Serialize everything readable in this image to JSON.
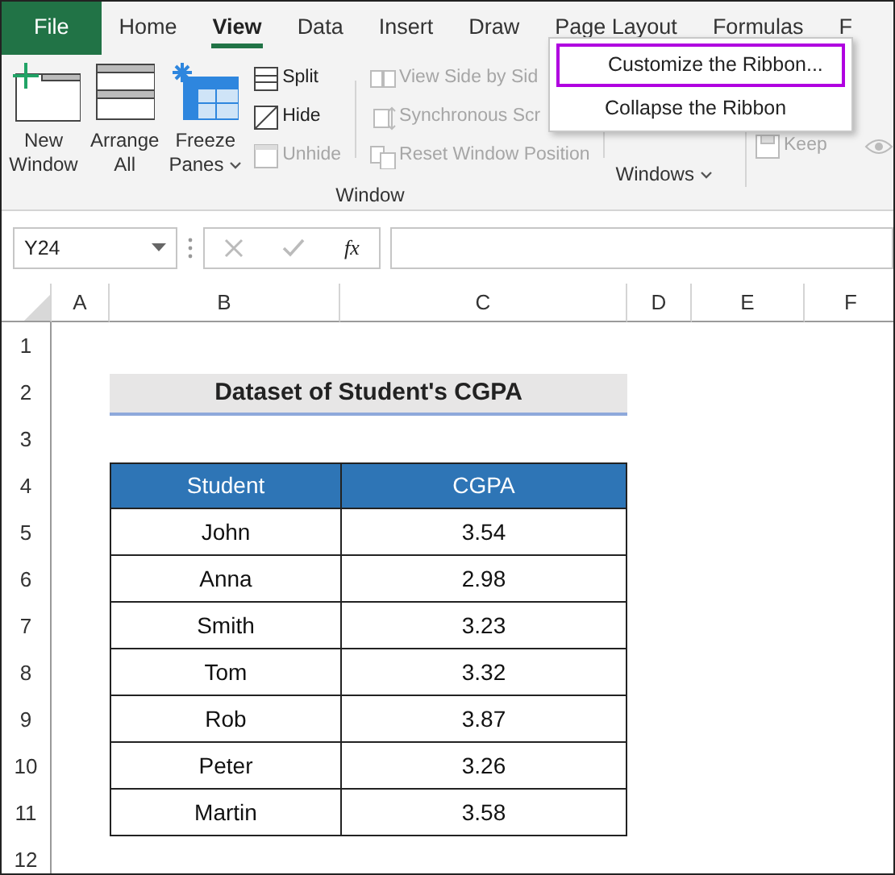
{
  "tabs": [
    {
      "label": "File",
      "kind": "file",
      "selected": false
    },
    {
      "label": "Home",
      "kind": "tab",
      "selected": false
    },
    {
      "label": "View",
      "kind": "tab",
      "selected": true
    },
    {
      "label": "Data",
      "kind": "tab",
      "selected": false
    },
    {
      "label": "Insert",
      "kind": "tab",
      "selected": false
    },
    {
      "label": "Draw",
      "kind": "tab",
      "selected": false
    },
    {
      "label": "Page Layout",
      "kind": "tab",
      "selected": false
    },
    {
      "label": "Formulas",
      "kind": "tab",
      "selected": false
    },
    {
      "label": "F",
      "kind": "tab",
      "selected": false
    }
  ],
  "ribbon": {
    "group_label": "Window",
    "large_buttons": [
      {
        "lines": [
          "New",
          "Window"
        ],
        "dropdown": false
      },
      {
        "lines": [
          "Arrange",
          "All"
        ],
        "dropdown": false
      },
      {
        "lines": [
          "Freeze",
          "Panes"
        ],
        "dropdown": true
      }
    ],
    "small_buttons": [
      {
        "label": "Split",
        "disabled": false
      },
      {
        "label": "Hide",
        "disabled": false
      },
      {
        "label": "Unhide",
        "disabled": true
      }
    ],
    "compare_buttons": [
      {
        "label": "View Side by Sid",
        "disabled": true
      },
      {
        "label": "Synchronous Scr",
        "disabled": true
      },
      {
        "label": "Reset Window Position",
        "disabled": true
      }
    ],
    "switch_button": {
      "lines": [
        "Windows"
      ],
      "dropdown": true
    },
    "keep_button": {
      "label": "Keep",
      "disabled": true
    }
  },
  "context_menu": [
    {
      "label": "Customize the Ribbon...",
      "highlighted": true
    },
    {
      "label": "Collapse the Ribbon",
      "highlighted": false
    }
  ],
  "formula_bar": {
    "name_box": "Y24",
    "function_label": "fx"
  },
  "sheet": {
    "column_headers": [
      "A",
      "B",
      "C",
      "D",
      "E",
      "F"
    ],
    "row_numbers": [
      "1",
      "2",
      "3",
      "4",
      "5",
      "6",
      "7",
      "8",
      "9",
      "10",
      "11",
      "12"
    ],
    "title": "Dataset of Student's CGPA",
    "headers": [
      "Student",
      "CGPA"
    ],
    "rows": [
      [
        "John",
        "3.54"
      ],
      [
        "Anna",
        "2.98"
      ],
      [
        "Smith",
        "3.23"
      ],
      [
        "Tom",
        "3.32"
      ],
      [
        "Rob",
        "3.87"
      ],
      [
        "Peter",
        "3.26"
      ],
      [
        "Martin",
        "3.58"
      ]
    ]
  }
}
